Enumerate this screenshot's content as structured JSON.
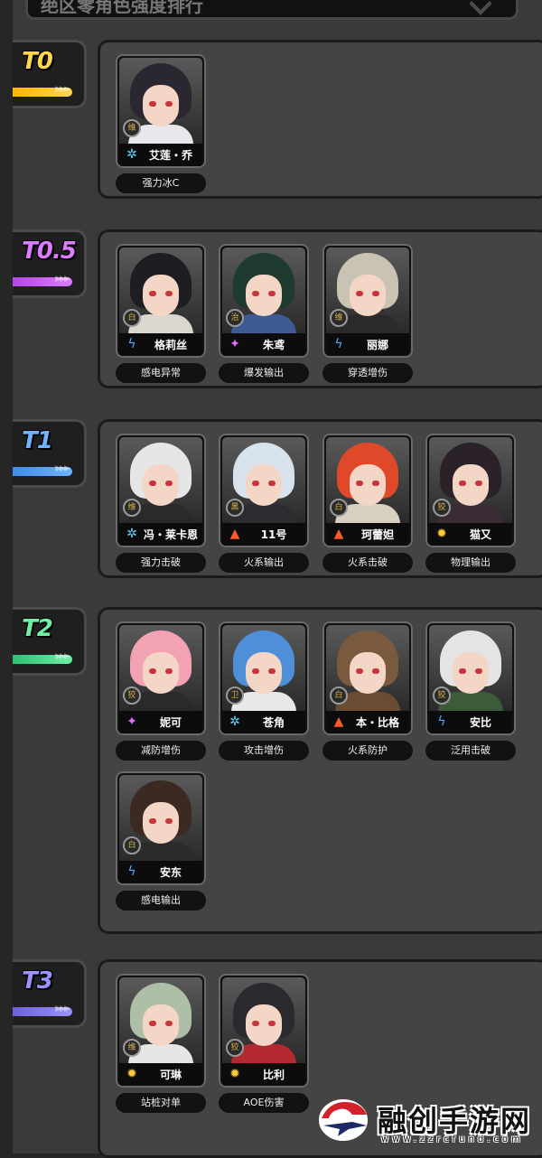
{
  "header": {
    "title": "绝区零角色强度排行"
  },
  "tiers": [
    {
      "label": "T0",
      "colors": [
        "#ffb400",
        "#ffd84a"
      ],
      "chars": [
        {
          "name": "艾莲・乔",
          "role": "强力冰C",
          "element": "冰",
          "elem_color": "#5fd6ff",
          "elem_glyph": "✲",
          "faction": "维",
          "hair": "#2a2730",
          "torso": "#e8e8ec"
        }
      ]
    },
    {
      "label": "T0.5",
      "colors": [
        "#b447e8",
        "#dd7cff"
      ],
      "chars": [
        {
          "name": "格莉丝",
          "role": "感电异常",
          "element": "电",
          "elem_color": "#4aa8ff",
          "elem_glyph": "ϟ",
          "faction": "白",
          "hair": "#1d1d22",
          "torso": "#d9d7d0"
        },
        {
          "name": "朱鸢",
          "role": "爆发输出",
          "element": "以太",
          "elem_color": "#e16cff",
          "elem_glyph": "✦",
          "faction": "治",
          "hair": "#1f3b30",
          "torso": "#3e5a94"
        },
        {
          "name": "丽娜",
          "role": "穿透增伤",
          "element": "电",
          "elem_color": "#4aa8ff",
          "elem_glyph": "ϟ",
          "faction": "维",
          "hair": "#c9c3b4",
          "torso": "#2a2a2a"
        }
      ]
    },
    {
      "label": "T1",
      "colors": [
        "#3f8de8",
        "#6fb3ff"
      ],
      "chars": [
        {
          "name": "冯・莱卡恩",
          "role": "强力击破",
          "element": "冰",
          "elem_color": "#5fd6ff",
          "elem_glyph": "✲",
          "faction": "维",
          "hair": "#e6e6e6",
          "torso": "#2a2a2a"
        },
        {
          "name": "11号",
          "role": "火系输出",
          "element": "火",
          "elem_color": "#ff5a2a",
          "elem_glyph": "▲",
          "faction": "黑",
          "hair": "#d8e2ec",
          "torso": "#2b2b30"
        },
        {
          "name": "珂蕾妲",
          "role": "火系击破",
          "element": "火",
          "elem_color": "#ff5a2a",
          "elem_glyph": "▲",
          "faction": "白",
          "hair": "#e0482a",
          "torso": "#d8d0c0"
        },
        {
          "name": "猫又",
          "role": "物理输出",
          "element": "物理",
          "elem_color": "#ffc93a",
          "elem_glyph": "✹",
          "faction": "狡",
          "hair": "#2a2228",
          "torso": "#3a2c34"
        }
      ]
    },
    {
      "label": "T2",
      "colors": [
        "#2fbf74",
        "#6df0a5"
      ],
      "chars": [
        {
          "name": "妮可",
          "role": "减防增伤",
          "element": "以太",
          "elem_color": "#e16cff",
          "elem_glyph": "✦",
          "faction": "狡",
          "hair": "#f2a2b2",
          "torso": "#2a2a2a"
        },
        {
          "name": "苍角",
          "role": "攻击增伤",
          "element": "冰",
          "elem_color": "#5fd6ff",
          "elem_glyph": "✲",
          "faction": "卫",
          "hair": "#4f8fd8",
          "torso": "#e8e8e8"
        },
        {
          "name": "本・比格",
          "role": "火系防护",
          "element": "火",
          "elem_color": "#ff5a2a",
          "elem_glyph": "▲",
          "faction": "白",
          "hair": "#7a5a3e",
          "torso": "#6a4c34"
        },
        {
          "name": "安比",
          "role": "泛用击破",
          "element": "电",
          "elem_color": "#4aa8ff",
          "elem_glyph": "ϟ",
          "faction": "狡",
          "hair": "#e4e4e4",
          "torso": "#3d5a3a"
        },
        {
          "name": "安东",
          "role": "感电输出",
          "element": "电",
          "elem_color": "#4aa8ff",
          "elem_glyph": "ϟ",
          "faction": "白",
          "hair": "#3a2a22",
          "torso": "#2b2b2b"
        }
      ]
    },
    {
      "label": "T3",
      "colors": [
        "#6a62d8",
        "#9a92ff"
      ],
      "chars": [
        {
          "name": "可琳",
          "role": "站桩对单",
          "element": "物理",
          "elem_color": "#ffc93a",
          "elem_glyph": "✹",
          "faction": "维",
          "hair": "#aebfa8",
          "torso": "#e6e6e6"
        },
        {
          "name": "比利",
          "role": "AOE伤害",
          "element": "物理",
          "elem_color": "#ffc93a",
          "elem_glyph": "✹",
          "faction": "狡",
          "hair": "#2a2a2e",
          "torso": "#b22a30"
        }
      ]
    }
  ],
  "watermark": {
    "title": "融创手游网",
    "domain": "www.zzrcfund.com"
  }
}
